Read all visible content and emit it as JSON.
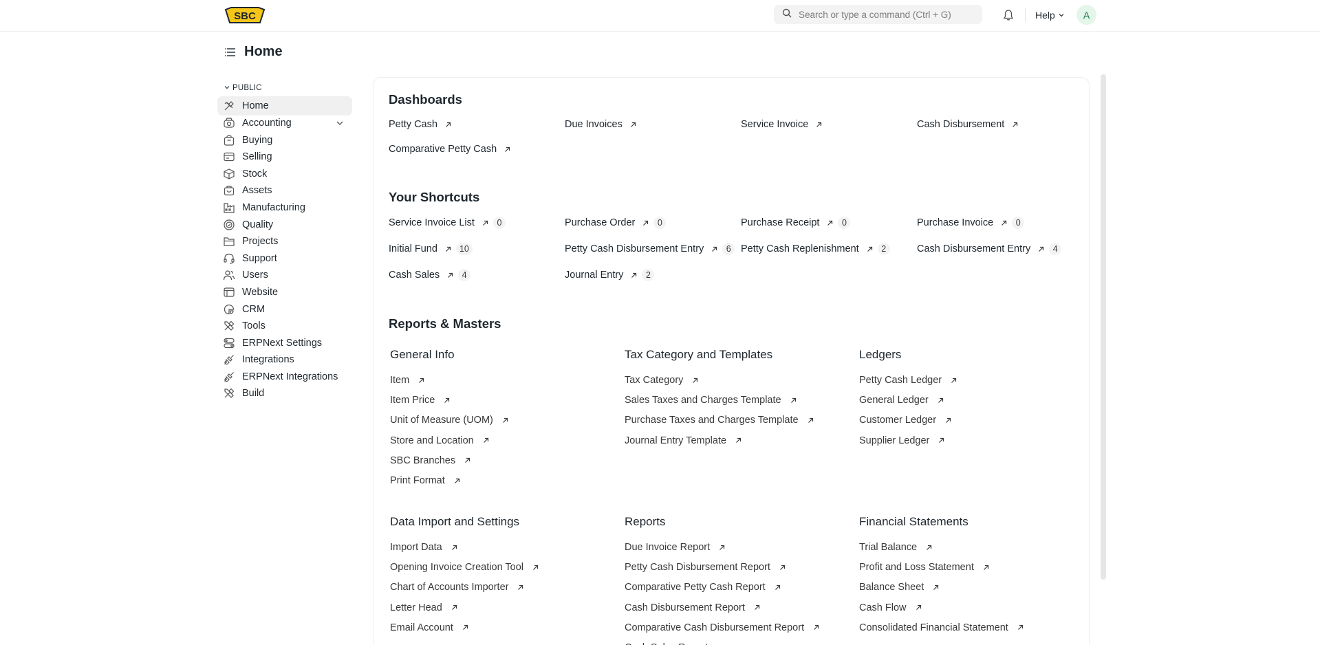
{
  "navbar": {
    "logo_text": "SBC",
    "search_placeholder": "Search or type a command (Ctrl + G)",
    "help_label": "Help",
    "avatar_initial": "A"
  },
  "page": {
    "title": "Home"
  },
  "sidebar": {
    "section_label": "PUBLIC",
    "items": [
      {
        "label": "Home",
        "icon": "home-icon",
        "active": true
      },
      {
        "label": "Accounting",
        "icon": "accounting-icon",
        "expandable": true
      },
      {
        "label": "Buying",
        "icon": "buying-icon"
      },
      {
        "label": "Selling",
        "icon": "selling-icon"
      },
      {
        "label": "Stock",
        "icon": "stock-icon"
      },
      {
        "label": "Assets",
        "icon": "assets-icon"
      },
      {
        "label": "Manufacturing",
        "icon": "manufacturing-icon"
      },
      {
        "label": "Quality",
        "icon": "quality-icon"
      },
      {
        "label": "Projects",
        "icon": "projects-icon"
      },
      {
        "label": "Support",
        "icon": "support-icon"
      },
      {
        "label": "Users",
        "icon": "users-icon"
      },
      {
        "label": "Website",
        "icon": "website-icon"
      },
      {
        "label": "CRM",
        "icon": "crm-icon"
      },
      {
        "label": "Tools",
        "icon": "tools-icon"
      },
      {
        "label": "ERPNext Settings",
        "icon": "settings-icon"
      },
      {
        "label": "Integrations",
        "icon": "integrations-icon"
      },
      {
        "label": "ERPNext Integrations",
        "icon": "erpnext-integrations-icon"
      },
      {
        "label": "Build",
        "icon": "build-icon"
      }
    ]
  },
  "dashboards": {
    "title": "Dashboards",
    "links": [
      "Petty Cash",
      "Due Invoices",
      "Service Invoice",
      "Cash Disbursement",
      "Comparative Petty Cash"
    ]
  },
  "shortcuts": {
    "title": "Your Shortcuts",
    "items": [
      {
        "label": "Service Invoice List",
        "count": "0"
      },
      {
        "label": "Purchase Order",
        "count": "0"
      },
      {
        "label": "Purchase Receipt",
        "count": "0"
      },
      {
        "label": "Purchase Invoice",
        "count": "0"
      },
      {
        "label": "Initial Fund",
        "count": "10"
      },
      {
        "label": "Petty Cash Disbursement Entry",
        "count": "6"
      },
      {
        "label": "Petty Cash Replenishment",
        "count": "2"
      },
      {
        "label": "Cash Disbursement Entry",
        "count": "4"
      },
      {
        "label": "Cash Sales",
        "count": "4"
      },
      {
        "label": "Journal Entry",
        "count": "2"
      }
    ]
  },
  "reports": {
    "title": "Reports & Masters",
    "cards": [
      {
        "title": "General Info",
        "links": [
          "Item",
          "Item Price",
          "Unit of Measure (UOM)",
          "Store and Location",
          "SBC Branches",
          "Print Format"
        ]
      },
      {
        "title": "Tax Category and Templates",
        "links": [
          "Tax Category",
          "Sales Taxes and Charges Template",
          "Purchase Taxes and Charges Template",
          "Journal Entry Template"
        ]
      },
      {
        "title": "Ledgers",
        "links": [
          "Petty Cash Ledger",
          "General Ledger",
          "Customer Ledger",
          "Supplier Ledger"
        ]
      },
      {
        "title": "Data Import and Settings",
        "links": [
          "Import Data",
          "Opening Invoice Creation Tool",
          "Chart of Accounts Importer",
          "Letter Head",
          "Email Account"
        ]
      },
      {
        "title": "Reports",
        "links": [
          "Due Invoice Report",
          "Petty Cash Disbursement Report",
          "Comparative Petty Cash Report",
          "Cash Disbursement Report",
          "Comparative Cash Disbursement Report",
          "Cash Sales Report"
        ]
      },
      {
        "title": "Financial Statements",
        "links": [
          "Trial Balance",
          "Profit and Loss Statement",
          "Balance Sheet",
          "Cash Flow",
          "Consolidated Financial Statement"
        ]
      }
    ]
  },
  "colors": {
    "text": "#1f272e",
    "active_bg": "#f0f0f0",
    "logo_yellow": "#f5c518",
    "avatar_bg": "#e4f5e9",
    "avatar_fg": "#16794c"
  }
}
